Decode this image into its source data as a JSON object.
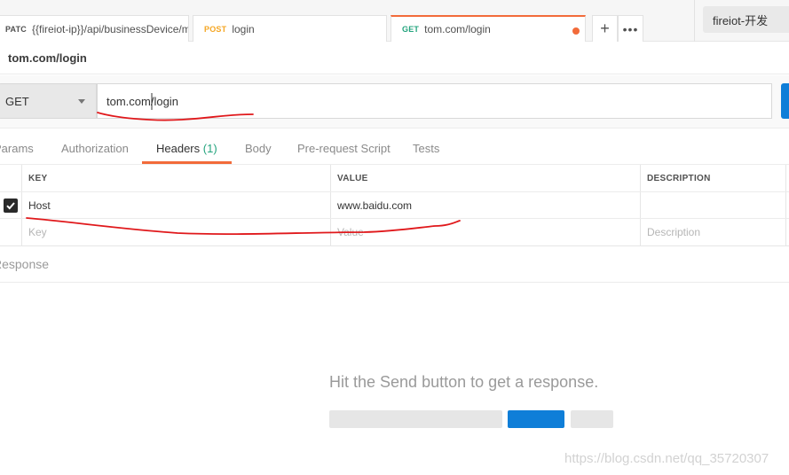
{
  "tabs": [
    {
      "method": "PATC",
      "method_color": "#505050",
      "label": "{{fireiot-ip}}/api/businessDevice/m"
    },
    {
      "method": "POST",
      "method_color": "#f5a623",
      "label": "login"
    },
    {
      "method": "GET",
      "method_color": "#24a47e",
      "label": "tom.com/login",
      "active": true,
      "unsaved": true
    }
  ],
  "tab_actions": {
    "add_icon": "plus-icon",
    "more_icon": "ellipsis-icon",
    "add_glyph": "+",
    "more_glyph": "•••"
  },
  "environment": {
    "selected": "fireiot-开发"
  },
  "request": {
    "name": "tom.com/login",
    "method": "GET",
    "url": "tom.com/login"
  },
  "subtabs": {
    "params": "Params",
    "authorization": "Authorization",
    "headers": "Headers",
    "headers_count": "(1)",
    "body": "Body",
    "prerequest": "Pre-request Script",
    "tests": "Tests",
    "active": "Headers"
  },
  "headers_table": {
    "columns": [
      "KEY",
      "VALUE",
      "DESCRIPTION"
    ],
    "rows": [
      {
        "checked": true,
        "key": "Host",
        "value": "www.baidu.com",
        "description": ""
      }
    ],
    "placeholders": {
      "key": "Key",
      "value": "Value",
      "description": "Description"
    }
  },
  "response": {
    "title": "Response",
    "empty_message": "Hit the Send button to get a response."
  },
  "watermark": "https://blog.csdn.net/qq_35720307",
  "colors": {
    "accent_orange": "#f26b3a",
    "send_blue": "#0f7ed8",
    "annotation_red": "#e0181b",
    "count_green": "#24a47e"
  }
}
